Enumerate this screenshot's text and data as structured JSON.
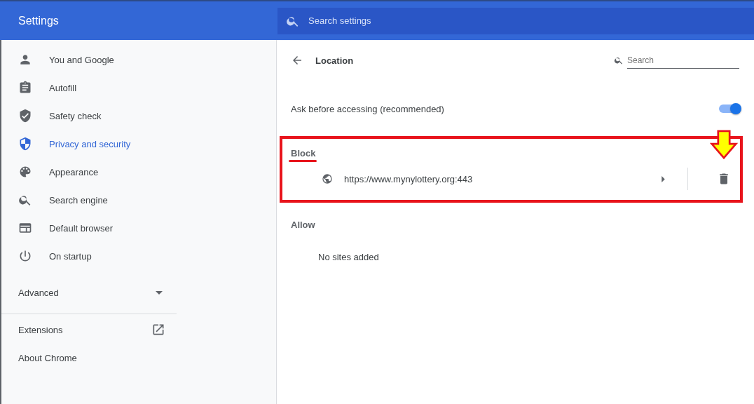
{
  "header": {
    "title": "Settings",
    "search": {
      "placeholder": "Search settings"
    }
  },
  "sidebar": {
    "items": [
      {
        "label": "You and Google",
        "kind": "person",
        "selected": false
      },
      {
        "label": "Autofill",
        "kind": "clipboard",
        "selected": false
      },
      {
        "label": "Safety check",
        "kind": "shield-check",
        "selected": false
      },
      {
        "label": "Privacy and security",
        "kind": "shield",
        "selected": true
      },
      {
        "label": "Appearance",
        "kind": "palette",
        "selected": false
      },
      {
        "label": "Search engine",
        "kind": "search",
        "selected": false
      },
      {
        "label": "Default browser",
        "kind": "browser",
        "selected": false
      },
      {
        "label": "On startup",
        "kind": "power",
        "selected": false
      }
    ],
    "advanced": {
      "label": "Advanced",
      "expanded": false
    },
    "links": [
      {
        "label": "Extensions",
        "external": true
      },
      {
        "label": "About Chrome",
        "external": false
      }
    ]
  },
  "page": {
    "title": "Location",
    "search": {
      "placeholder": "Search"
    },
    "toggle": {
      "label": "Ask before accessing (recommended)",
      "on": true
    },
    "block": {
      "heading": "Block",
      "sites": [
        {
          "url": "https://www.mynylottery.org:443"
        }
      ]
    },
    "allow": {
      "heading": "Allow",
      "empty": "No sites added"
    }
  }
}
